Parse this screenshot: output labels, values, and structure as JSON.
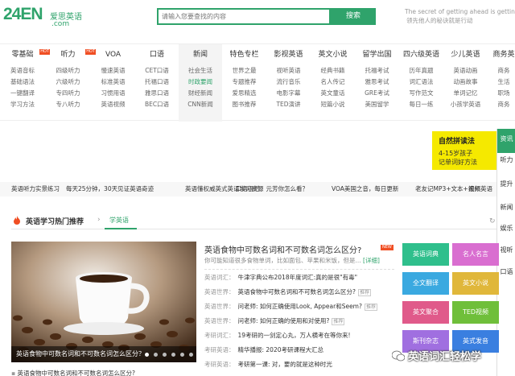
{
  "header": {
    "logo_num": "24EN",
    "logo_cn": "爱思英语",
    "logo_domain": ".com",
    "search_placeholder": "请输入您要查找的内容",
    "search_button": "搜索",
    "slogan_line1": "The secret of getting ahead is getting sta",
    "slogan_line2": "领先他人的秘诀就是行动"
  },
  "nav": [
    {
      "head": "零基础",
      "badge": "HOT",
      "items": [
        "英语音标",
        "基础语法",
        "一键翻译",
        "学习方法"
      ]
    },
    {
      "head": "听力",
      "badge": "HOT",
      "items": [
        "四级听力",
        "六级听力",
        "专四听力",
        "专八听力"
      ]
    },
    {
      "head": "VOA",
      "items": [
        "慢速英语",
        "标准英语",
        "习惯用语",
        "英语视频"
      ]
    },
    {
      "head": "口语",
      "items": [
        "CET口语",
        "托福口语",
        "雅思口语",
        "BEC口语"
      ]
    },
    {
      "head": "新闻",
      "items": [
        "社会生活",
        "时政要闻",
        "财经新闻",
        "CNN新闻"
      ]
    },
    {
      "head": "特色专栏",
      "items": [
        "世界之最",
        "专题推荐",
        "爱思精选",
        "图书推荐"
      ]
    },
    {
      "head": "影视英语",
      "items": [
        "视听英语",
        "流行音乐",
        "电影字幕",
        "TED演讲"
      ]
    },
    {
      "head": "英文小说",
      "items": [
        "经典书籍",
        "名人传记",
        "英文童话",
        "短篇小说"
      ]
    },
    {
      "head": "留学出国",
      "items": [
        "托福考试",
        "雅思考试",
        "GRE考试",
        "美国留学"
      ]
    },
    {
      "head": "四六级英语",
      "items": [
        "历年真题",
        "词汇语法",
        "写作范文",
        "每日一练"
      ]
    },
    {
      "head": "少儿英语",
      "items": [
        "英语动画",
        "动画故事",
        "单词记忆",
        "小孩学英语"
      ]
    },
    {
      "head": "商务英",
      "items": [
        "商务",
        "生活",
        "职场",
        "商务"
      ]
    }
  ],
  "promo": {
    "title": "自然拼读法",
    "line1": "4-15岁孩子",
    "line2": "记单词好方法"
  },
  "side": [
    "资讯",
    "听力",
    "提升",
    "新闻",
    "娱乐",
    "视听",
    "口语"
  ],
  "ticker": [
    "英语听力实景练习",
    "每天25分钟，30天见证英语奇迹",
    "英语懂权威英式英语学习资源",
    "口语很烂，元芳你怎么看？",
    "VOA美国之音，每日更新",
    "老友记MP3+文本+视频",
    "滚州英语"
  ],
  "section": {
    "title": "英语学习热门推荐",
    "tab": "学英语"
  },
  "hero_caption": "英语食物中可数名词和不可数名词怎么区分？",
  "article": {
    "title": "英语食物中可数名词和不可数名词怎么区分?",
    "badge": "NEW",
    "desc": "你可能知道很多食物单词，比如面包、苹果和米饭，但是...",
    "more": "[详细]"
  },
  "rows": [
    {
      "cat": "英语词汇：",
      "txt": "牛津字典公布2018年度词汇:真的是很\"有毒\"",
      "tag": ""
    },
    {
      "cat": "英语世界：",
      "txt": "英语食物中可数名词和不可数名词怎么区分?",
      "tag": "推荐"
    },
    {
      "cat": "英语世界：",
      "txt": "问老师: 如何正确使用Look, Appear和Seem?",
      "tag": "推荐"
    },
    {
      "cat": "英语世界：",
      "txt": "问老师: 如何正确的使用和对使用?",
      "tag": "推荐"
    },
    {
      "cat": "考研词汇：",
      "txt": "19考研的一剑定心丸，万人横考在等你来!",
      "tag": ""
    },
    {
      "cat": "考研英语：",
      "txt": "精华播报: 2020考研课程大汇总",
      "tag": ""
    },
    {
      "cat": "考研英语：",
      "txt": "考研第一课: 对，要的就是这种时光",
      "tag": ""
    }
  ],
  "tiles": [
    {
      "label": "英语词典",
      "color": "#2fbf8c"
    },
    {
      "label": "名人名言",
      "color": "#d96ed0"
    },
    {
      "label": "全文翻译",
      "color": "#3aa9e0"
    },
    {
      "label": "英文小说",
      "color": "#e0b73a"
    },
    {
      "label": "英文聚合",
      "color": "#e05a8a"
    },
    {
      "label": "TED视频",
      "color": "#6fbf3a"
    },
    {
      "label": "斯刊杂志",
      "color": "#a06fe0"
    },
    {
      "label": "英式发音",
      "color": "#3a7fe0"
    }
  ],
  "watermark": "英语词汇轻松学",
  "bottom_text": "英语食物中可数名词和不可数名词怎么区分?"
}
